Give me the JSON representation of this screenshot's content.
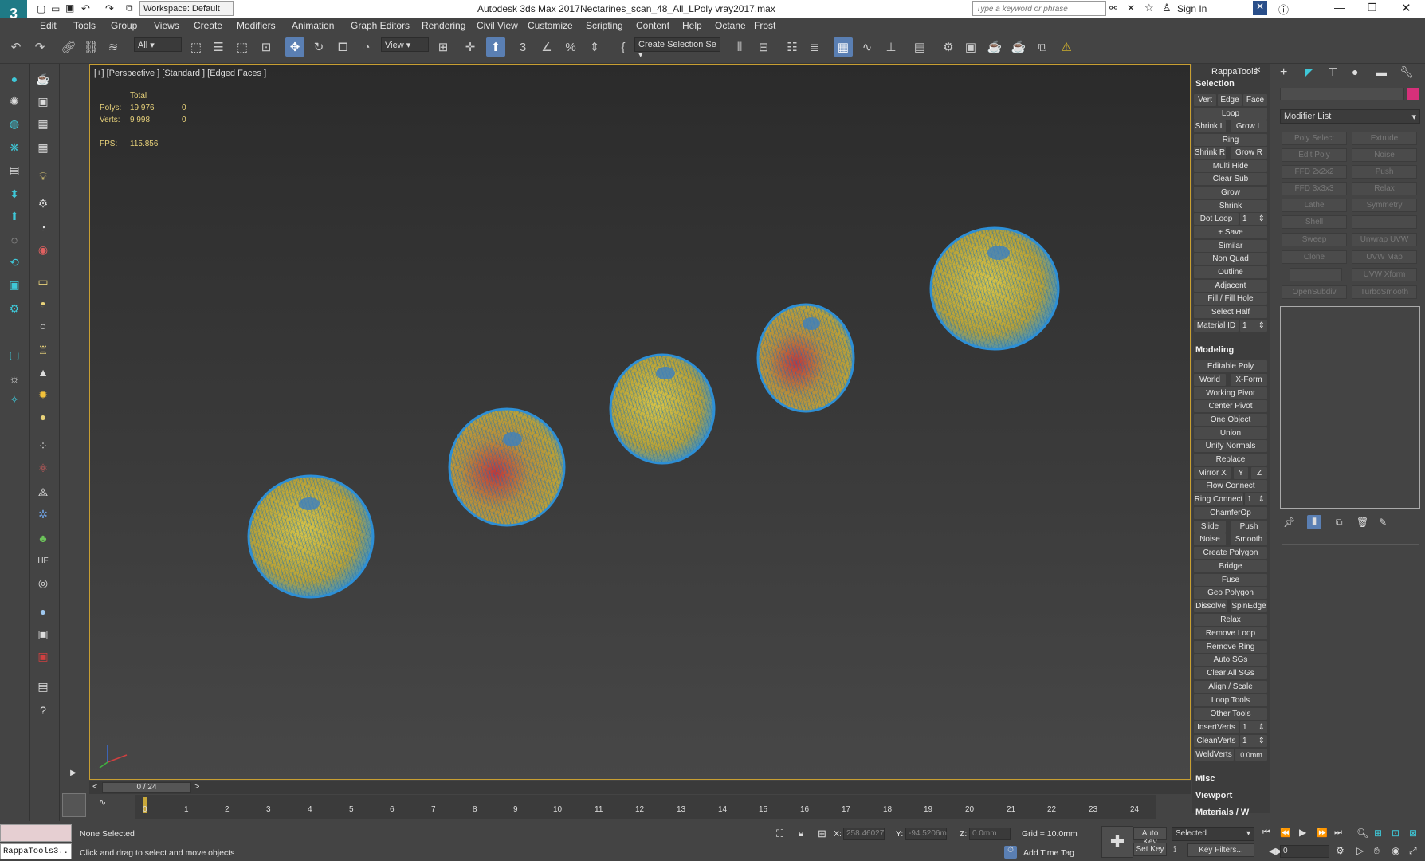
{
  "titlebar": {
    "workspace": "Workspace: Default",
    "app_title": "Autodesk 3ds Max 2017",
    "file_title": "Nectarines_scan_48_All_LPoly vray2017.max",
    "search_placeholder": "Type a keyword or phrase",
    "sign_in": "Sign In"
  },
  "menu": [
    "Edit",
    "Tools",
    "Group",
    "Views",
    "Create",
    "Modifiers",
    "Animation",
    "Graph Editors",
    "Rendering",
    "Civil View",
    "Customize",
    "Scripting",
    "Content",
    "Help",
    "Octane",
    "Frost"
  ],
  "toolbar": {
    "filter_value": "All",
    "refcoord_value": "View",
    "selection_set_value": "Create Selection Se"
  },
  "viewport": {
    "label": "[+] [Perspective ] [Standard ] [Edged Faces ]",
    "stats": {
      "header": "Total",
      "polys_label": "Polys:",
      "polys_total": "19 976",
      "polys_sel": "0",
      "verts_label": "Verts:",
      "verts_total": "9 998",
      "verts_sel": "0",
      "fps_label": "FPS:",
      "fps_value": "115.856"
    }
  },
  "rappa": {
    "title": "RappaTools",
    "sections": {
      "selection": "Selection",
      "modeling": "Modeling",
      "misc": "Misc",
      "viewport": "Viewport",
      "materials": "Materials / W"
    },
    "selection_buttons": {
      "vert": "Vert",
      "edge": "Edge",
      "face": "Face",
      "loop": "Loop",
      "shrink_l": "Shrink L",
      "grow_l": "Grow L",
      "ring": "Ring",
      "shrink_r": "Shrink R",
      "grow_r": "Grow R",
      "multi_hide": "Multi Hide",
      "clear_sub": "Clear Sub",
      "grow": "Grow",
      "shrink": "Shrink",
      "dot_loop": "Dot Loop",
      "dot_loop_val": "1",
      "save": "+ Save",
      "similar": "Similar",
      "non_quad": "Non Quad",
      "outline": "Outline",
      "adjacent": "Adjacent",
      "fill_hole": "Fill / Fill Hole",
      "select_half": "Select Half",
      "material_id": "Material ID",
      "material_id_val": "1"
    },
    "modeling_buttons": {
      "editable_poly": "Editable Poly",
      "world": "World",
      "xform": "X-Form",
      "working_pivot": "Working Pivot",
      "center_pivot": "Center Pivot",
      "one_object": "One Object",
      "union": "Union",
      "unify_normals": "Unify Normals",
      "replace": "Replace",
      "mirror_x": "Mirror X",
      "y": "Y",
      "z": "Z",
      "flow_connect": "Flow Connect",
      "ring_connect": "Ring Connect",
      "ring_connect_val": "1",
      "chamferop": "ChamferOp",
      "slide": "Slide",
      "push": "Push",
      "noise": "Noise",
      "smooth": "Smooth",
      "create_polygon": "Create Polygon",
      "bridge": "Bridge",
      "fuse": "Fuse",
      "geo_polygon": "Geo Polygon",
      "dissolve": "Dissolve",
      "spinedge": "SpinEdge",
      "relax": "Relax",
      "remove_loop": "Remove Loop",
      "remove_ring": "Remove Ring",
      "auto_sgs": "Auto SGs",
      "clear_all_sgs": "Clear All SGs",
      "align_scale": "Align / Scale",
      "loop_tools": "Loop Tools",
      "other_tools": "Other Tools",
      "insertverts": "InsertVerts",
      "insertverts_val": "1",
      "cleanverts": "CleanVerts",
      "cleanverts_val": "1",
      "weldverts": "WeldVerts",
      "weldverts_val": "0.0mm"
    }
  },
  "command_panel": {
    "modifier_list": "Modifier List",
    "modifiers": [
      "Poly Select",
      "Extrude",
      "Edit Poly",
      "Noise",
      "FFD 2x2x2",
      "Push",
      "FFD 3x3x3",
      "Relax",
      "Lathe",
      "Symmetry",
      "Shell",
      "",
      "Sweep",
      "Unwrap UVW",
      "Clone",
      "UVW Map",
      "",
      "UVW Xform",
      "OpenSubdiv",
      "TurboSmooth"
    ]
  },
  "timeline": {
    "frame_counter": "0 / 24",
    "ticks": [
      "0",
      "1",
      "2",
      "3",
      "4",
      "5",
      "6",
      "7",
      "8",
      "9",
      "10",
      "11",
      "12",
      "13",
      "14",
      "15",
      "16",
      "17",
      "18",
      "19",
      "20",
      "21",
      "22",
      "23",
      "24"
    ]
  },
  "status": {
    "maxscript": "RappaTools3..",
    "selection": "None Selected",
    "prompt": "Click and drag to select and move objects",
    "x_label": "X:",
    "x_value": "258.46027",
    "y_label": "Y:",
    "y_value": "-94.5206m",
    "z_label": "Z:",
    "z_value": "0.0mm",
    "grid": "Grid = 10.0mm",
    "add_time_tag": "Add Time Tag",
    "auto_key": "Auto Key",
    "set_key": "Set Key",
    "selected": "Selected",
    "key_filters": "Key Filters...",
    "frame_value": "0"
  },
  "colors": {
    "viewport_border": "#c89f32",
    "active_tool": "#5a7fb3",
    "fruit_wire": "#2d8fd6",
    "fruit_yellow": "#c9b43a",
    "fruit_red": "#b8322f"
  }
}
